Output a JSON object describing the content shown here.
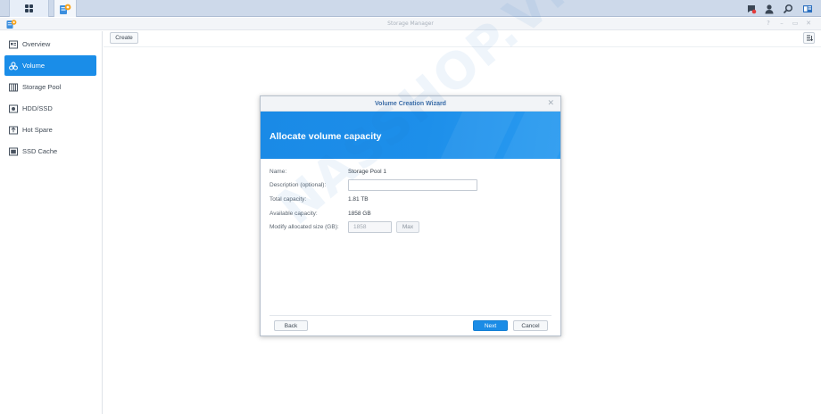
{
  "taskbar": {
    "main_menu_icon": "grid-icon",
    "app_icon": "storage-manager-icon",
    "right_icons": [
      "notification-icon",
      "user-icon",
      "search-icon",
      "widgets-icon"
    ]
  },
  "window": {
    "title": "Storage Manager",
    "controls": [
      "?",
      "–",
      "▭",
      "✕"
    ]
  },
  "sidebar": {
    "items": [
      {
        "label": "Overview",
        "icon": "overview-icon"
      },
      {
        "label": "Volume",
        "icon": "volume-icon",
        "active": true
      },
      {
        "label": "Storage Pool",
        "icon": "storage-pool-icon"
      },
      {
        "label": "HDD/SSD",
        "icon": "hdd-icon"
      },
      {
        "label": "Hot Spare",
        "icon": "hot-spare-icon"
      },
      {
        "label": "SSD Cache",
        "icon": "ssd-cache-icon"
      }
    ]
  },
  "toolbar": {
    "create_label": "Create",
    "sort_icon": "sort-icon"
  },
  "wizard": {
    "title": "Volume Creation Wizard",
    "close": "✕",
    "banner_title": "Allocate volume capacity",
    "fields": {
      "name_label": "Name:",
      "name_value": "Storage Pool 1",
      "description_label": "Description (optional):",
      "description_value": "",
      "total_label": "Total capacity:",
      "total_value": "1.81 TB",
      "available_label": "Available capacity:",
      "available_value": "1858 GB",
      "modify_label": "Modify allocated size (GB):",
      "modify_value": "1858",
      "max_label": "Max"
    },
    "buttons": {
      "back": "Back",
      "next": "Next",
      "cancel": "Cancel"
    }
  },
  "watermark": "NASSHOP.VN",
  "colors": {
    "accent": "#1a8de8",
    "taskbar": "#cdd9ea",
    "wizard_title": "#3d6da7"
  }
}
